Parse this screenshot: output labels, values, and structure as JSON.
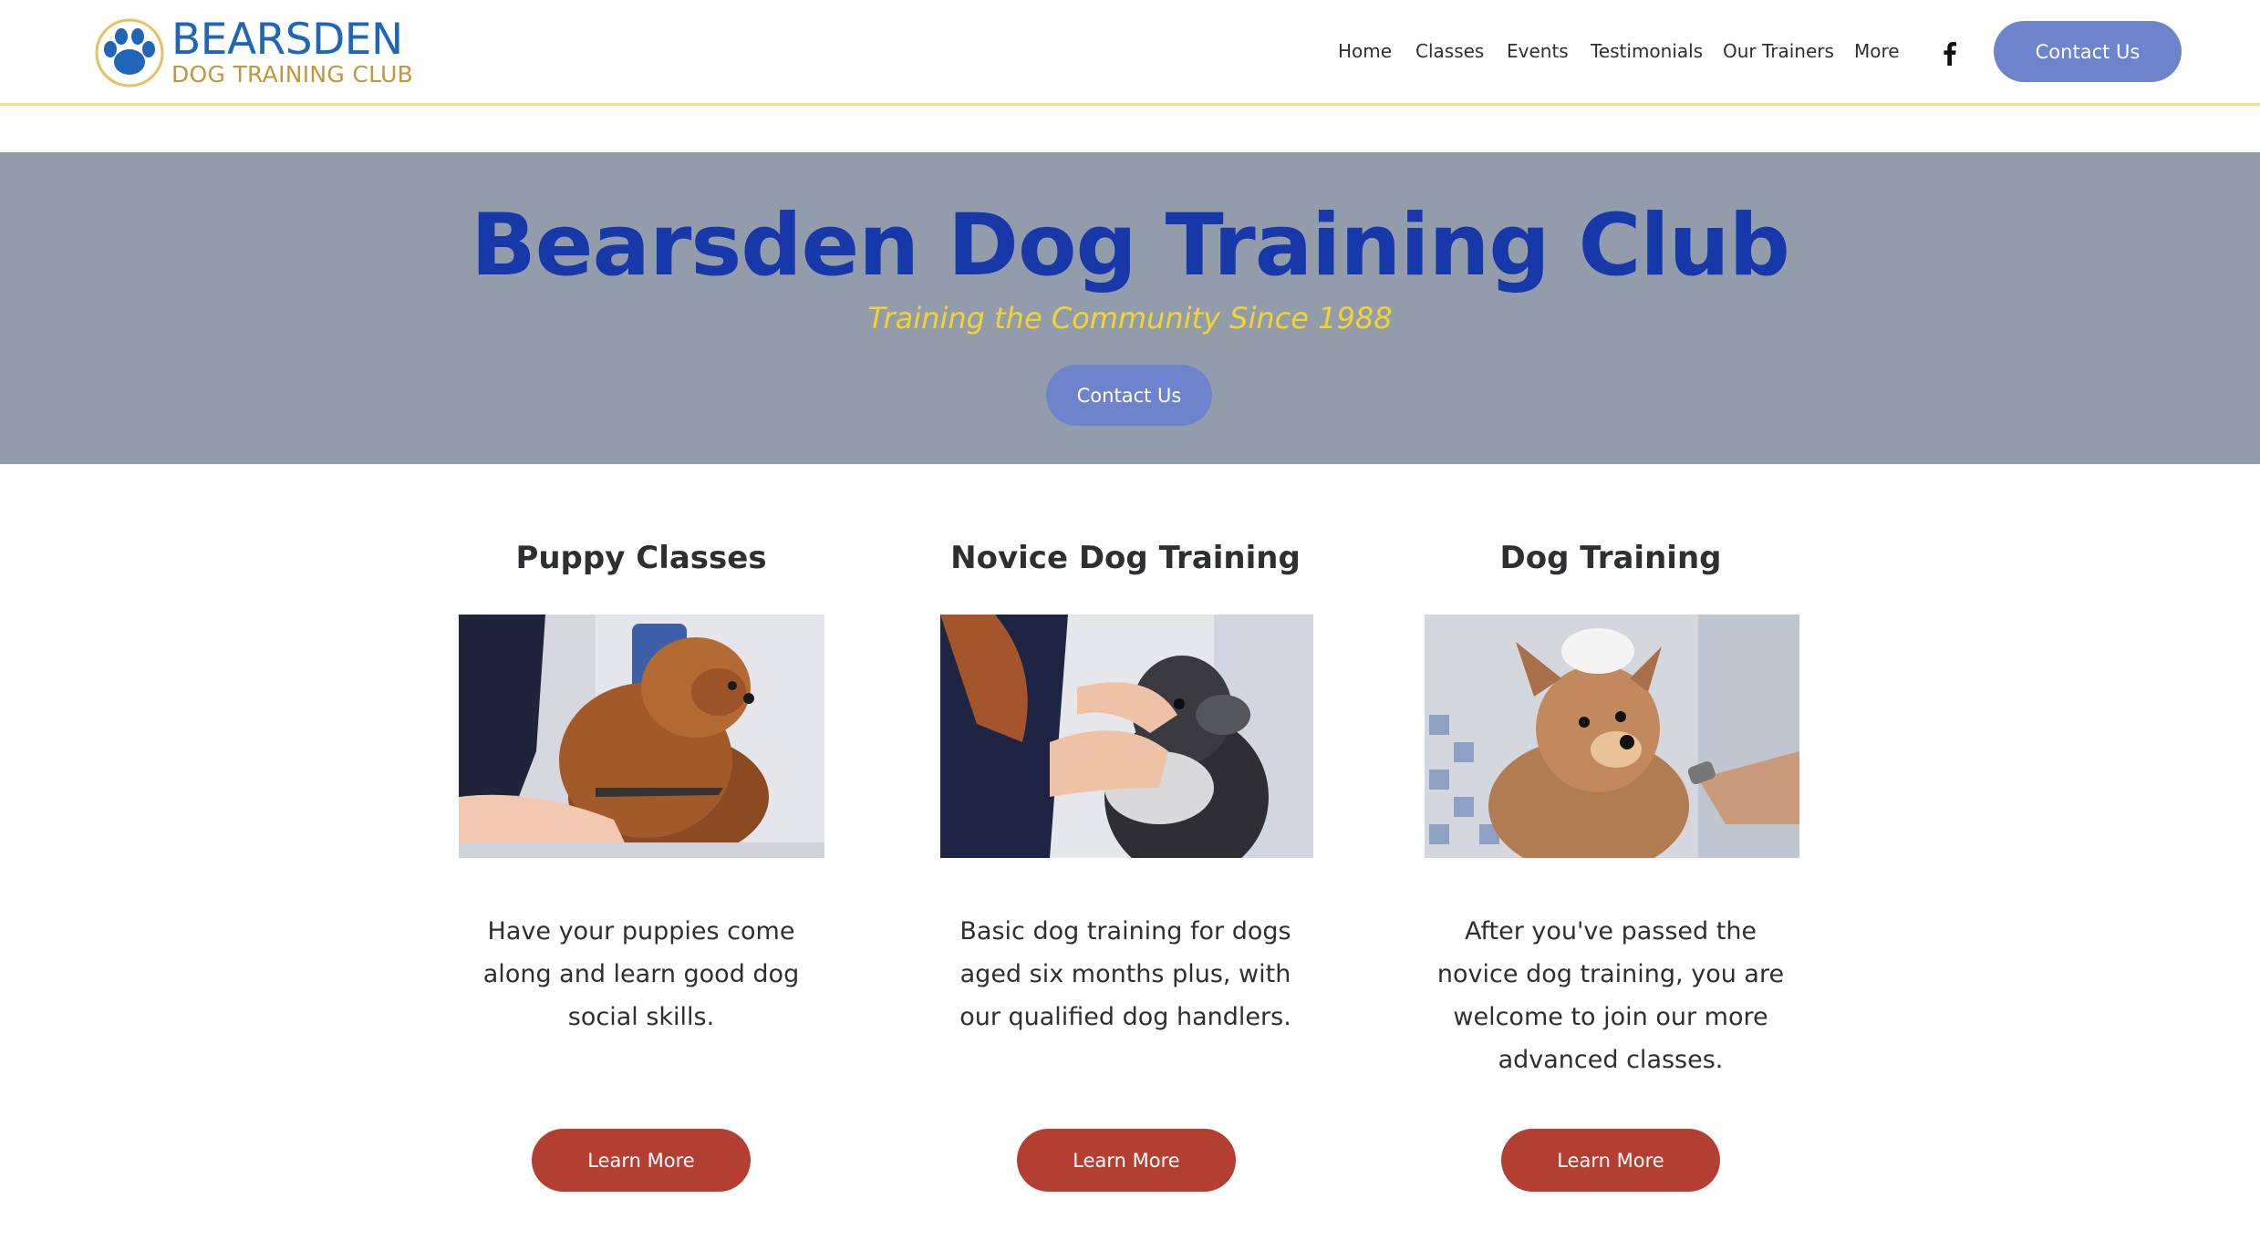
{
  "brand": {
    "title": "BEARSDEN",
    "subtitle": "DOG TRAINING CLUB",
    "primary_color": "#1f66b8",
    "secondary_color": "#c3963c",
    "icon": "paw-print-icon"
  },
  "nav": {
    "items": [
      {
        "label": "Home"
      },
      {
        "label": "Classes"
      },
      {
        "label": "Events"
      },
      {
        "label": "Testimonials"
      },
      {
        "label": "Our Trainers"
      },
      {
        "label": "More"
      }
    ],
    "social_icon": "facebook-icon",
    "cta_label": "Contact Us",
    "cta_color": "#6d84cc"
  },
  "hero": {
    "title": "Bearsden Dog Training Club",
    "subtitle": "Training the Community Since 1988",
    "cta_label": "Contact Us",
    "background": "#939cab",
    "title_color": "#1738a8",
    "subtitle_color": "#f3d331"
  },
  "cards": [
    {
      "title": "Puppy Classes",
      "image": "pomeranian-grooming-photo",
      "text": "Have your puppies come along and learn good dog social skills.",
      "button_label": "Learn More"
    },
    {
      "title": "Novice Dog Training",
      "image": "schnauzer-washing-photo",
      "text": "Basic dog training for dogs aged six months plus, with our qualified dog handlers.",
      "button_label": "Learn More"
    },
    {
      "title": "Dog Training",
      "image": "dog-shower-photo",
      "text": "After you've passed the novice dog training, you are welcome to join our more advanced classes.",
      "button_label": "Learn More"
    }
  ],
  "colors": {
    "button_red": "#b23f31",
    "header_border": "#f1e27c"
  }
}
